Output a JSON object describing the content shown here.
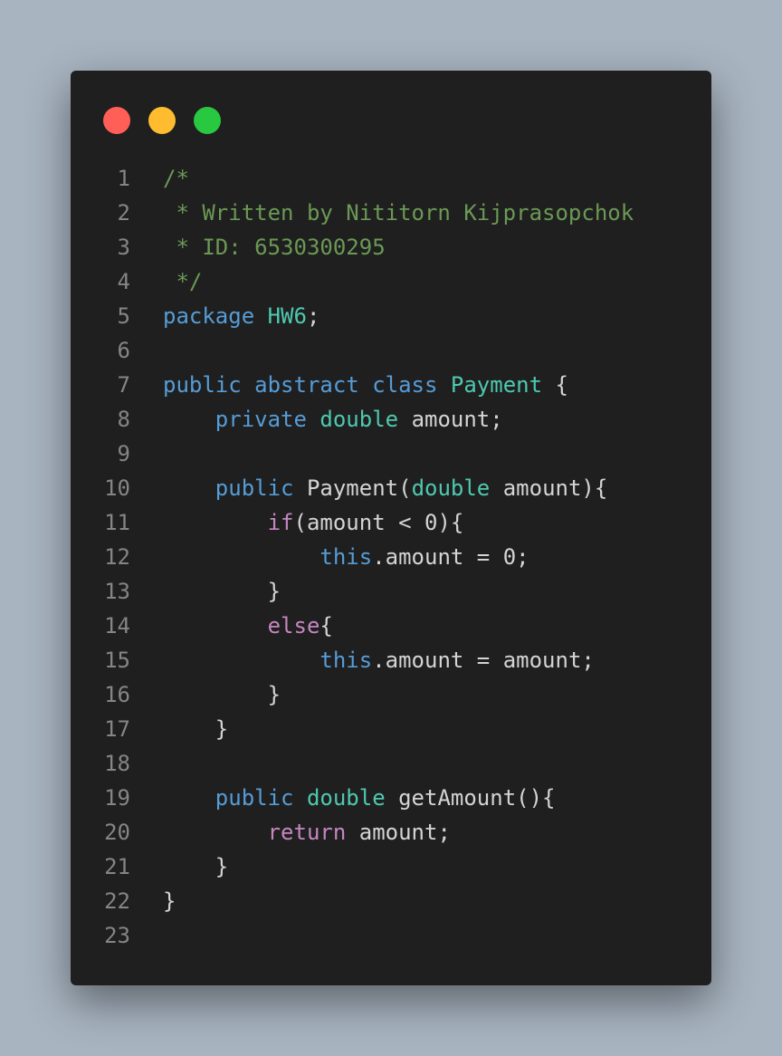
{
  "window": {
    "controls": [
      {
        "name": "close",
        "color": "#ff5f57"
      },
      {
        "name": "minimize",
        "color": "#febc2e"
      },
      {
        "name": "maximize",
        "color": "#28c840"
      }
    ]
  },
  "colors": {
    "comment": "#6a9955",
    "keyword": "#569cd6",
    "control": "#c586c0",
    "type": "#4ec9b0",
    "function": "#dcdcaa",
    "variable": "#9cdcfe",
    "number": "#b5cea8",
    "plain": "#d4d4d4",
    "line_number": "#858585",
    "background": "#1f1f1f"
  },
  "code": {
    "lines": [
      {
        "n": "1",
        "tokens": [
          {
            "t": "/*",
            "c": "comment"
          }
        ]
      },
      {
        "n": "2",
        "tokens": [
          {
            "t": " * Written by Nititorn Kijprasopchok",
            "c": "comment"
          }
        ]
      },
      {
        "n": "3",
        "tokens": [
          {
            "t": " * ID: 6530300295",
            "c": "comment"
          }
        ]
      },
      {
        "n": "4",
        "tokens": [
          {
            "t": " */",
            "c": "comment"
          }
        ]
      },
      {
        "n": "5",
        "tokens": [
          {
            "t": "package",
            "c": "keyword"
          },
          {
            "t": " ",
            "c": "plain"
          },
          {
            "t": "HW6",
            "c": "type"
          },
          {
            "t": ";",
            "c": "plain"
          }
        ]
      },
      {
        "n": "6",
        "tokens": []
      },
      {
        "n": "7",
        "tokens": [
          {
            "t": "public",
            "c": "keyword"
          },
          {
            "t": " ",
            "c": "plain"
          },
          {
            "t": "abstract",
            "c": "keyword"
          },
          {
            "t": " ",
            "c": "plain"
          },
          {
            "t": "class",
            "c": "keyword"
          },
          {
            "t": " ",
            "c": "plain"
          },
          {
            "t": "Payment",
            "c": "type"
          },
          {
            "t": " {",
            "c": "plain"
          }
        ]
      },
      {
        "n": "8",
        "tokens": [
          {
            "t": "    ",
            "c": "plain"
          },
          {
            "t": "private",
            "c": "keyword"
          },
          {
            "t": " ",
            "c": "plain"
          },
          {
            "t": "double",
            "c": "type"
          },
          {
            "t": " ",
            "c": "plain"
          },
          {
            "t": "amount",
            "c": "variable"
          },
          {
            "t": ";",
            "c": "plain"
          }
        ]
      },
      {
        "n": "9",
        "tokens": []
      },
      {
        "n": "10",
        "tokens": [
          {
            "t": "    ",
            "c": "plain"
          },
          {
            "t": "public",
            "c": "keyword"
          },
          {
            "t": " ",
            "c": "plain"
          },
          {
            "t": "Payment",
            "c": "function"
          },
          {
            "t": "(",
            "c": "plain"
          },
          {
            "t": "double",
            "c": "type"
          },
          {
            "t": " ",
            "c": "plain"
          },
          {
            "t": "amount",
            "c": "variable"
          },
          {
            "t": "){",
            "c": "plain"
          }
        ]
      },
      {
        "n": "11",
        "tokens": [
          {
            "t": "        ",
            "c": "plain"
          },
          {
            "t": "if",
            "c": "control"
          },
          {
            "t": "(",
            "c": "plain"
          },
          {
            "t": "amount",
            "c": "variable"
          },
          {
            "t": " < ",
            "c": "plain"
          },
          {
            "t": "0",
            "c": "number"
          },
          {
            "t": "){",
            "c": "plain"
          }
        ]
      },
      {
        "n": "12",
        "tokens": [
          {
            "t": "            ",
            "c": "plain"
          },
          {
            "t": "this",
            "c": "keyword"
          },
          {
            "t": ".",
            "c": "plain"
          },
          {
            "t": "amount",
            "c": "variable"
          },
          {
            "t": " = ",
            "c": "plain"
          },
          {
            "t": "0",
            "c": "number"
          },
          {
            "t": ";",
            "c": "plain"
          }
        ]
      },
      {
        "n": "13",
        "tokens": [
          {
            "t": "        }",
            "c": "plain"
          }
        ]
      },
      {
        "n": "14",
        "tokens": [
          {
            "t": "        ",
            "c": "plain"
          },
          {
            "t": "else",
            "c": "control"
          },
          {
            "t": "{",
            "c": "plain"
          }
        ]
      },
      {
        "n": "15",
        "tokens": [
          {
            "t": "            ",
            "c": "plain"
          },
          {
            "t": "this",
            "c": "keyword"
          },
          {
            "t": ".",
            "c": "plain"
          },
          {
            "t": "amount",
            "c": "variable"
          },
          {
            "t": " = ",
            "c": "plain"
          },
          {
            "t": "amount",
            "c": "variable"
          },
          {
            "t": ";",
            "c": "plain"
          }
        ]
      },
      {
        "n": "16",
        "tokens": [
          {
            "t": "        }",
            "c": "plain"
          }
        ]
      },
      {
        "n": "17",
        "tokens": [
          {
            "t": "    }",
            "c": "plain"
          }
        ]
      },
      {
        "n": "18",
        "tokens": []
      },
      {
        "n": "19",
        "tokens": [
          {
            "t": "    ",
            "c": "plain"
          },
          {
            "t": "public",
            "c": "keyword"
          },
          {
            "t": " ",
            "c": "plain"
          },
          {
            "t": "double",
            "c": "type"
          },
          {
            "t": " ",
            "c": "plain"
          },
          {
            "t": "getAmount",
            "c": "function"
          },
          {
            "t": "(){",
            "c": "plain"
          }
        ]
      },
      {
        "n": "20",
        "tokens": [
          {
            "t": "        ",
            "c": "plain"
          },
          {
            "t": "return",
            "c": "control"
          },
          {
            "t": " ",
            "c": "plain"
          },
          {
            "t": "amount",
            "c": "variable"
          },
          {
            "t": ";",
            "c": "plain"
          }
        ]
      },
      {
        "n": "21",
        "tokens": [
          {
            "t": "    }",
            "c": "plain"
          }
        ]
      },
      {
        "n": "22",
        "tokens": [
          {
            "t": "}",
            "c": "plain"
          }
        ]
      },
      {
        "n": "23",
        "tokens": []
      }
    ]
  }
}
